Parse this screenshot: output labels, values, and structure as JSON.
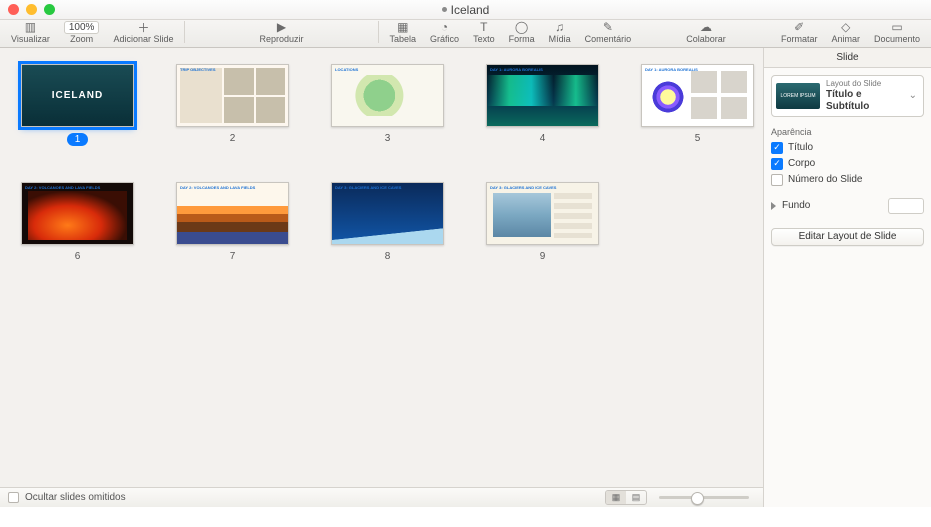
{
  "window": {
    "title": "Iceland"
  },
  "toolbar": {
    "view": "Visualizar",
    "zoom_label": "Zoom",
    "zoom_value": "100%",
    "add_slide": "Adicionar Slide",
    "play": "Reproduzir",
    "table": "Tabela",
    "chart": "Gráfico",
    "text": "Texto",
    "shape": "Forma",
    "media": "Mídia",
    "comment": "Comentário",
    "collaborate": "Colaborar",
    "format": "Formatar",
    "animate": "Animar",
    "document": "Documento"
  },
  "slides": [
    {
      "n": "1",
      "label": "ICELAND",
      "cls": "s1",
      "selected": true
    },
    {
      "n": "2",
      "label": "TRIP OBJECTIVES",
      "cls": "s2"
    },
    {
      "n": "3",
      "label": "LOCATIONS",
      "cls": "s3"
    },
    {
      "n": "4",
      "label": "DAY 1: AURORA BOREALIS",
      "cls": "s4"
    },
    {
      "n": "5",
      "label": "DAY 1: AURORA BOREALIS",
      "cls": "s5"
    },
    {
      "n": "6",
      "label": "DAY 2: VOLCANOES AND LAVA FIELDS",
      "cls": "s6"
    },
    {
      "n": "7",
      "label": "DAY 2: VOLCANOES AND LAVA FIELDS",
      "cls": "s7"
    },
    {
      "n": "8",
      "label": "DAY 3: GLACIERS AND ICE CAVES",
      "cls": "s8"
    },
    {
      "n": "9",
      "label": "DAY 3: GLACIERS AND ICE CAVES",
      "cls": "s9"
    }
  ],
  "footer": {
    "hide_skipped": "Ocultar slides omitidos"
  },
  "inspector": {
    "tab": "Slide",
    "layout_caption": "Layout do Slide",
    "layout_name": "Título e Subtítulo",
    "layout_thumb_text": "LOREM IPSUM",
    "appearance": "Aparência",
    "opt_title": "Título",
    "opt_body": "Corpo",
    "opt_slidenum": "Número do Slide",
    "background": "Fundo",
    "edit_layout": "Editar Layout de Slide"
  }
}
